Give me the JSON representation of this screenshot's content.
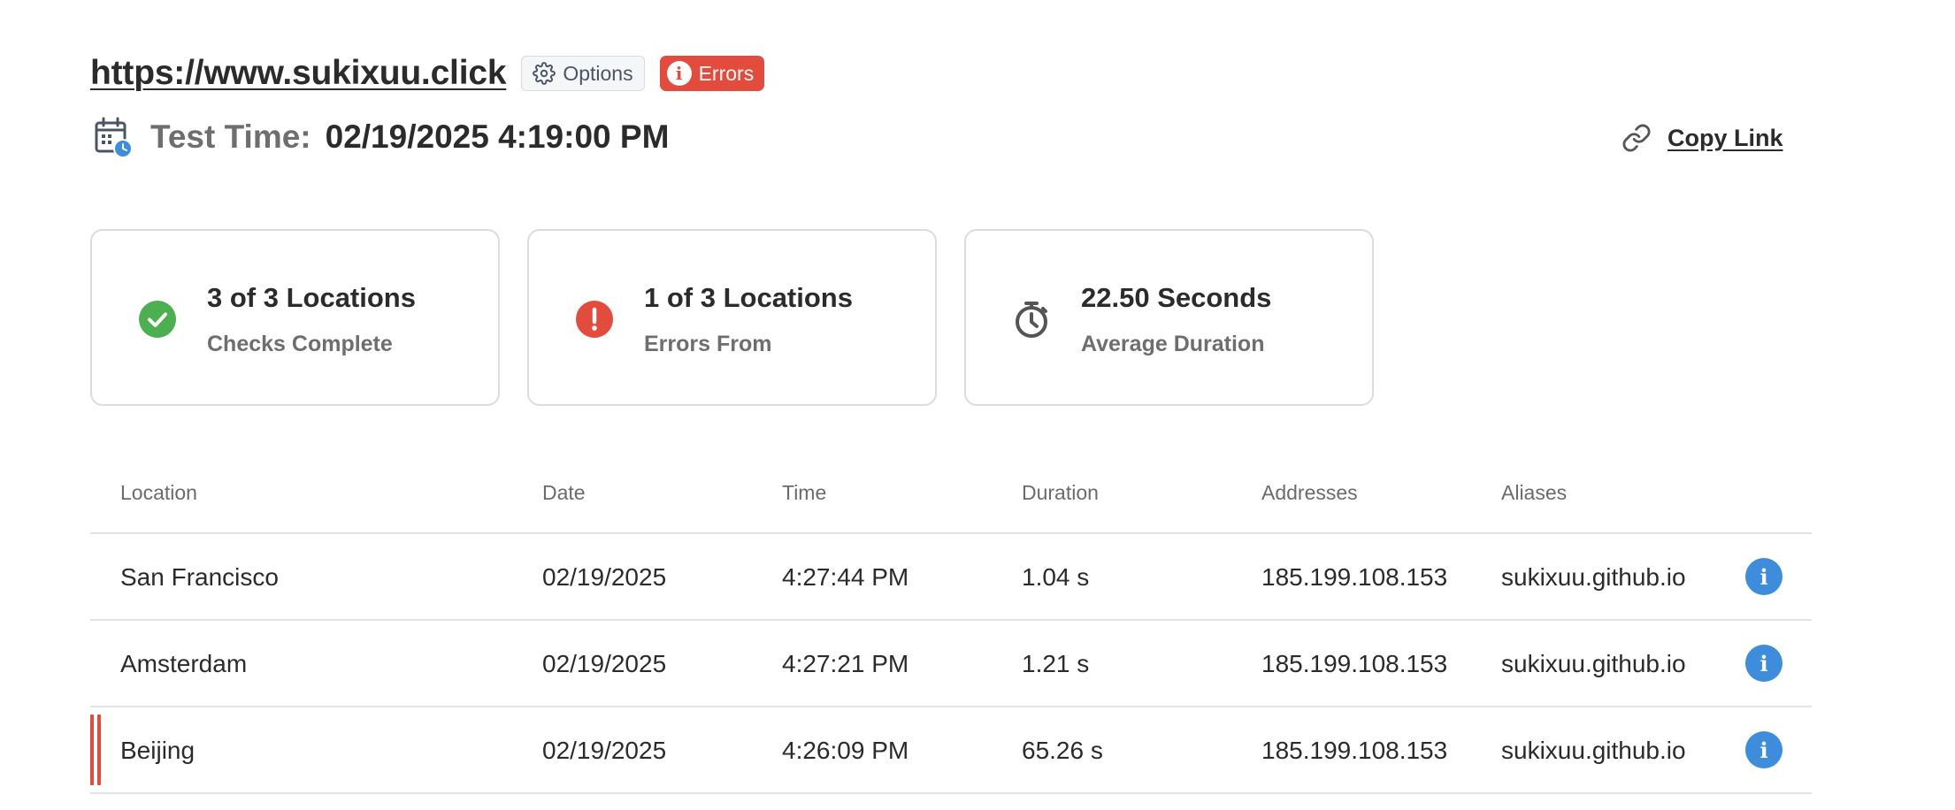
{
  "header": {
    "site_url": "https://www.sukixuu.click",
    "options_label": "Options",
    "errors_label": "Errors",
    "test_time_label": "Test Time:",
    "test_time_value": "02/19/2025 4:19:00 PM",
    "copy_link_label": "Copy Link"
  },
  "summary": [
    {
      "value": "3 of 3 Locations",
      "caption": "Checks Complete",
      "icon": "check-circle-icon",
      "color": "#4caf50"
    },
    {
      "value": "1 of 3 Locations",
      "caption": "Errors From",
      "icon": "exclamation-circle-icon",
      "color": "#e34b3c"
    },
    {
      "value": "22.50 Seconds",
      "caption": "Average Duration",
      "icon": "stopwatch-icon",
      "color": "#555555"
    }
  ],
  "table": {
    "columns": [
      "Location",
      "Date",
      "Time",
      "Duration",
      "Addresses",
      "Aliases"
    ],
    "rows": [
      {
        "location": "San Francisco",
        "date": "02/19/2025",
        "time": "4:27:44 PM",
        "duration": "1.04 s",
        "address": "185.199.108.153",
        "alias": "sukixuu.github.io",
        "error": false
      },
      {
        "location": "Amsterdam",
        "date": "02/19/2025",
        "time": "4:27:21 PM",
        "duration": "1.21 s",
        "address": "185.199.108.153",
        "alias": "sukixuu.github.io",
        "error": false
      },
      {
        "location": "Beijing",
        "date": "02/19/2025",
        "time": "4:26:09 PM",
        "duration": "65.26 s",
        "address": "185.199.108.153",
        "alias": "sukixuu.github.io",
        "error": true
      }
    ]
  },
  "colors": {
    "error": "#e34b3c",
    "success": "#4caf50",
    "info": "#3d8ddc",
    "text": "#2b2b2b",
    "muted": "#6e6e6e"
  }
}
